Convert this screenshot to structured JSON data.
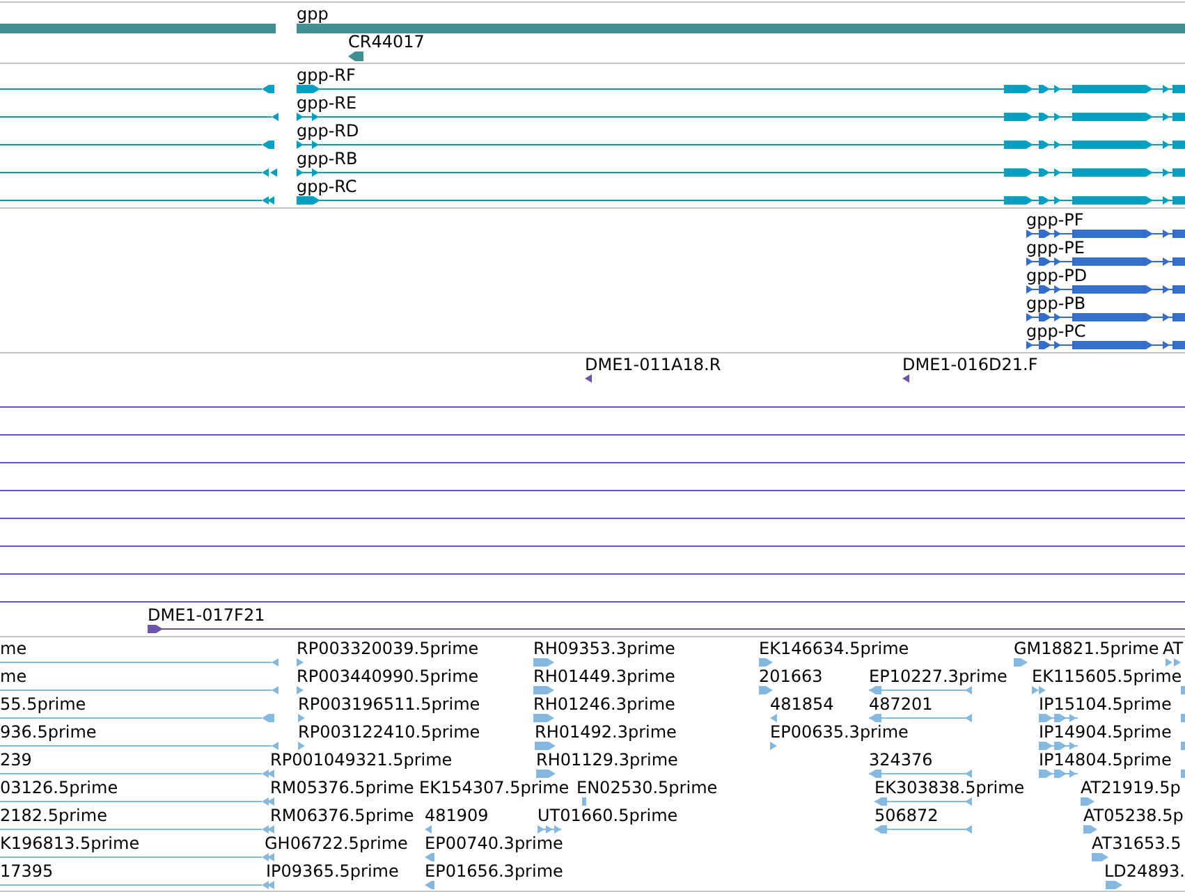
{
  "tracks": [
    {
      "kind": "gene",
      "features": [
        {
          "label": "gpp"
        },
        {
          "label": "CR44017"
        }
      ]
    },
    {
      "kind": "transcript",
      "features": [
        {
          "label": "gpp-RF"
        },
        {
          "label": "gpp-RE"
        },
        {
          "label": "gpp-RD"
        },
        {
          "label": "gpp-RB"
        },
        {
          "label": "gpp-RC"
        }
      ]
    },
    {
      "kind": "protein",
      "features": [
        {
          "label": "gpp-PF"
        },
        {
          "label": "gpp-PE"
        },
        {
          "label": "gpp-PD"
        },
        {
          "label": "gpp-PB"
        },
        {
          "label": "gpp-PC"
        }
      ]
    },
    {
      "kind": "clone",
      "features": [
        {
          "label": "DME1-011A18.R"
        },
        {
          "label": "DME1-016D21.F"
        },
        {
          "label": "DME1-017F21"
        }
      ]
    },
    {
      "kind": "est",
      "features": [
        {
          "label": "me"
        },
        {
          "label": "RP003320039.5prime"
        },
        {
          "label": "RH09353.3prime"
        },
        {
          "label": "EK146634.5prime"
        },
        {
          "label": "GM18821.5prime"
        },
        {
          "label": "AT"
        },
        {
          "label": "me"
        },
        {
          "label": "RP003440990.5prime"
        },
        {
          "label": "RH01449.3prime"
        },
        {
          "label": "201663"
        },
        {
          "label": "EP10227.3prime"
        },
        {
          "label": "EK115605.5prime"
        },
        {
          "label": "55.5prime"
        },
        {
          "label": "RP003196511.5prime"
        },
        {
          "label": "RH01246.3prime"
        },
        {
          "label": "481854"
        },
        {
          "label": "487201"
        },
        {
          "label": "IP15104.5prime"
        },
        {
          "label": "936.5prime"
        },
        {
          "label": "RP003122410.5prime"
        },
        {
          "label": "RH01492.3prime"
        },
        {
          "label": "EP00635.3prime"
        },
        {
          "label": "IP14904.5prime"
        },
        {
          "label": "239"
        },
        {
          "label": "RP001049321.5prime"
        },
        {
          "label": "RH01129.3prime"
        },
        {
          "label": "324376"
        },
        {
          "label": "IP14804.5prime"
        },
        {
          "label": "03126.5prime"
        },
        {
          "label": "RM05376.5prime"
        },
        {
          "label": "EK154307.5prime"
        },
        {
          "label": "EN02530.5prime"
        },
        {
          "label": "EK303838.5prime"
        },
        {
          "label": "AT21919.5p"
        },
        {
          "label": "2182.5prime"
        },
        {
          "label": "RM06376.5prime"
        },
        {
          "label": "481909"
        },
        {
          "label": "UT01660.5prime"
        },
        {
          "label": "506872"
        },
        {
          "label": "AT05238.5p"
        },
        {
          "label": "K196813.5prime"
        },
        {
          "label": "GH06722.5prime"
        },
        {
          "label": "EP00740.3prime"
        },
        {
          "label": "AT31653.5"
        },
        {
          "label": "17395"
        },
        {
          "label": "IP09365.5prime"
        },
        {
          "label": "EP01656.3prime"
        },
        {
          "label": "LD24893."
        }
      ]
    }
  ]
}
